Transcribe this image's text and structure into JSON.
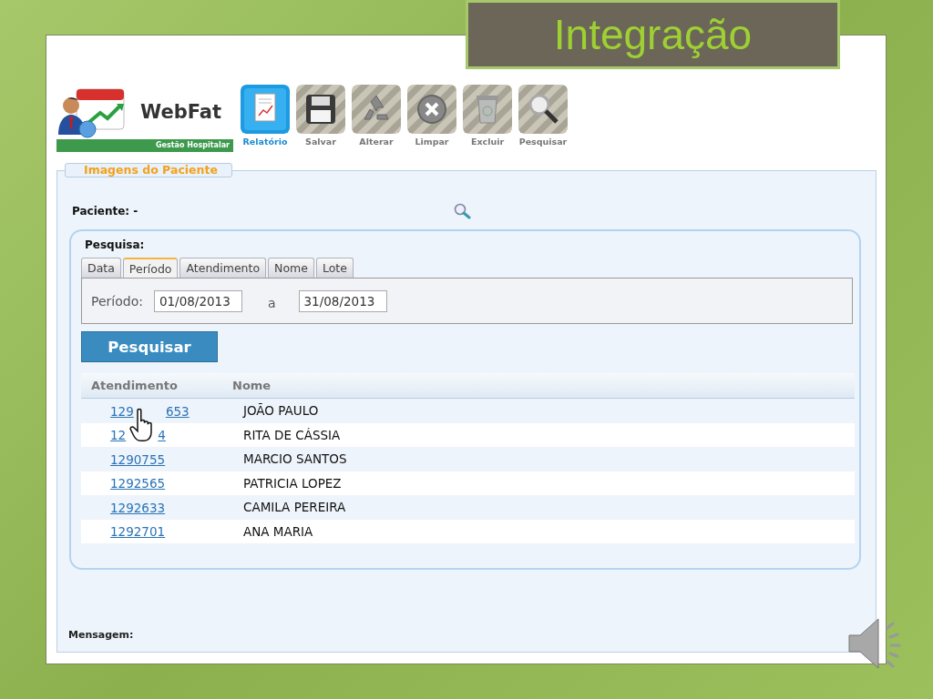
{
  "slide": {
    "title": "Integração"
  },
  "app": {
    "logo": {
      "name": "WebFat",
      "subtitle": "Gestão Hospitalar"
    },
    "toolbar": [
      {
        "label": "Relatório",
        "selected": true
      },
      {
        "label": "Salvar",
        "selected": false
      },
      {
        "label": "Alterar",
        "selected": false
      },
      {
        "label": "Limpar",
        "selected": false
      },
      {
        "label": "Excluir",
        "selected": false
      },
      {
        "label": "Pesquisar",
        "selected": false
      }
    ],
    "section_title": "Imagens do Paciente",
    "patient": {
      "label": "Paciente: -"
    },
    "search": {
      "title": "Pesquisa:",
      "tabs": [
        {
          "label": "Data",
          "selected": false
        },
        {
          "label": "Período",
          "selected": true
        },
        {
          "label": "Atendimento",
          "selected": false
        },
        {
          "label": "Nome",
          "selected": false
        },
        {
          "label": "Lote",
          "selected": false
        }
      ],
      "period": {
        "label": "Período:",
        "from": "01/08/2013",
        "separator": "a",
        "to": "31/08/2013"
      },
      "button": "Pesquisar"
    },
    "table": {
      "columns": [
        "Atendimento",
        "Nome"
      ],
      "rows": [
        {
          "atendimento": [
            "129",
            "653"
          ],
          "nome": "JOÃO PAULO"
        },
        {
          "atendimento": [
            "12",
            "4"
          ],
          "nome": "RITA DE CÁSSIA"
        },
        {
          "atendimento": [
            "1290755"
          ],
          "nome": "MARCIO SANTOS"
        },
        {
          "atendimento": [
            "1292565"
          ],
          "nome": "PATRICIA LOPEZ"
        },
        {
          "atendimento": [
            "1292633"
          ],
          "nome": "CAMILA PEREIRA"
        },
        {
          "atendimento": [
            "1292701"
          ],
          "nome": "ANA MARIA"
        }
      ]
    },
    "message": {
      "label": "Mensagem:"
    }
  }
}
